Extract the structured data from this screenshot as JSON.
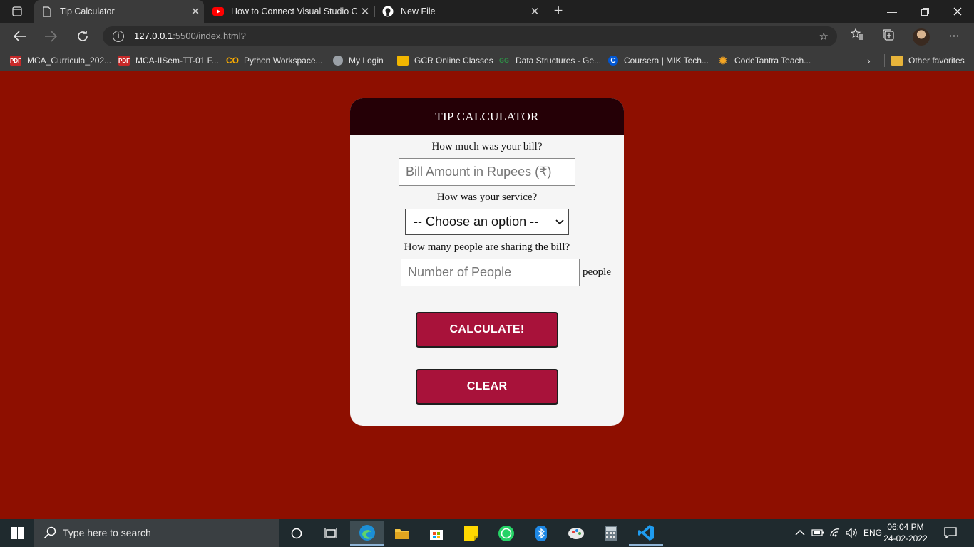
{
  "browser": {
    "tabs": [
      {
        "title": "Tip Calculator",
        "icon": "page-icon",
        "active": true
      },
      {
        "title": "How to Connect Visual Studio Co",
        "icon": "youtube-icon",
        "active": false
      },
      {
        "title": "New File",
        "icon": "github-icon",
        "active": false
      }
    ],
    "url_host": "127.0.0.1",
    "url_rest": ":5500/index.html?",
    "favorites": [
      {
        "label": "MCA_Curricula_202...",
        "icon": "pdf-icon"
      },
      {
        "label": "MCA-IISem-TT-01 F...",
        "icon": "pdf-icon"
      },
      {
        "label": "Python Workspace...",
        "icon": "colab-icon"
      },
      {
        "label": "My Login",
        "icon": "login-icon"
      },
      {
        "label": "GCR Online Classes",
        "icon": "classroom-icon"
      },
      {
        "label": "Data Structures - Ge...",
        "icon": "gfg-icon"
      },
      {
        "label": "Coursera | MIK Tech...",
        "icon": "coursera-icon"
      },
      {
        "label": "CodeTantra Teach...",
        "icon": "codetantra-icon"
      }
    ],
    "other_favorites": "Other favorites"
  },
  "app": {
    "title": "TIP CALCULATOR",
    "bill_question": "How much was your bill?",
    "bill_placeholder": "Bill Amount in Rupees (₹)",
    "service_question": "How was your service?",
    "service_selected": "-- Choose an option --",
    "people_question": "How many people are sharing the bill?",
    "people_placeholder": "Number of People",
    "people_suffix": "people",
    "calculate_label": "CALCULATE!",
    "clear_label": "CLEAR"
  },
  "taskbar": {
    "search_placeholder": "Type here to search",
    "language": "ENG",
    "time": "06:04 PM",
    "date": "24-02-2022"
  },
  "colors": {
    "page_background": "#8e0f00",
    "card_header": "#250006",
    "button": "#a8123a"
  }
}
